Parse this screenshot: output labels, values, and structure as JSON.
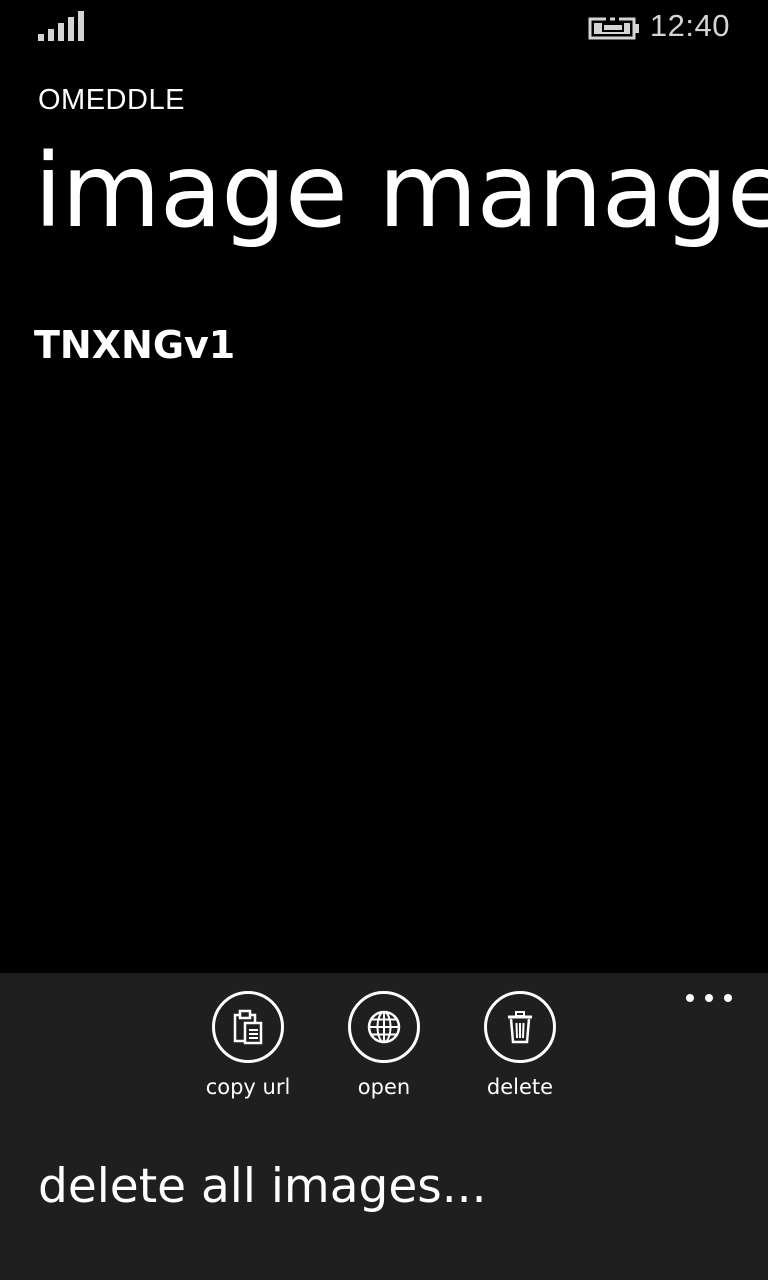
{
  "status_bar": {
    "time": "12:40",
    "signal_icon": "signal-strength-icon",
    "battery_icon": "battery-charging-icon"
  },
  "header": {
    "app_title": "OMEDDLE",
    "page_title": "image manage"
  },
  "images": [
    {
      "name": "TNXNGv1"
    }
  ],
  "app_bar": {
    "background": "#1f1f1f",
    "buttons": [
      {
        "label": "copy url",
        "icon": "clipboard-icon"
      },
      {
        "label": "open",
        "icon": "globe-icon"
      },
      {
        "label": "delete",
        "icon": "trash-icon"
      }
    ],
    "more_icon": "ellipsis-icon",
    "menu_items": [
      {
        "label": "delete all images..."
      }
    ]
  }
}
